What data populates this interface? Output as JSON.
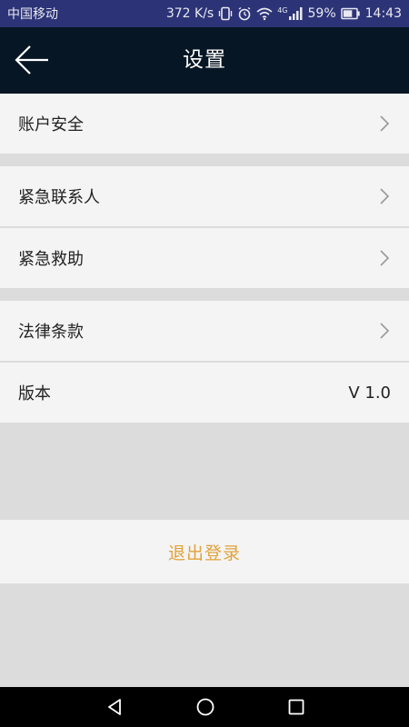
{
  "status_bar": {
    "carrier": "中国移动",
    "net_speed": "372 K/s",
    "signal_type": "4G",
    "battery": "59%",
    "time": "14:43",
    "icons": [
      "vibrate-icon",
      "alarm-icon",
      "wifi-icon",
      "signal-icon",
      "battery-icon"
    ]
  },
  "header": {
    "title": "设置",
    "back_icon": "back-arrow-icon"
  },
  "settings": {
    "account_security": "账户安全",
    "emergency_contacts": "紧急联系人",
    "emergency_rescue": "紧急救助",
    "legal_terms": "法律条款",
    "version_label": "版本",
    "version_value": "V 1.0"
  },
  "logout_label": "退出登录",
  "colors": {
    "status_bar": "#2c3477",
    "header": "#071624",
    "logout_text": "#e2a23a",
    "background": "#dcdcdc",
    "row": "#f4f4f4"
  },
  "system_nav": {
    "icons": [
      "back-triangle-icon",
      "home-circle-icon",
      "recents-square-icon"
    ]
  }
}
